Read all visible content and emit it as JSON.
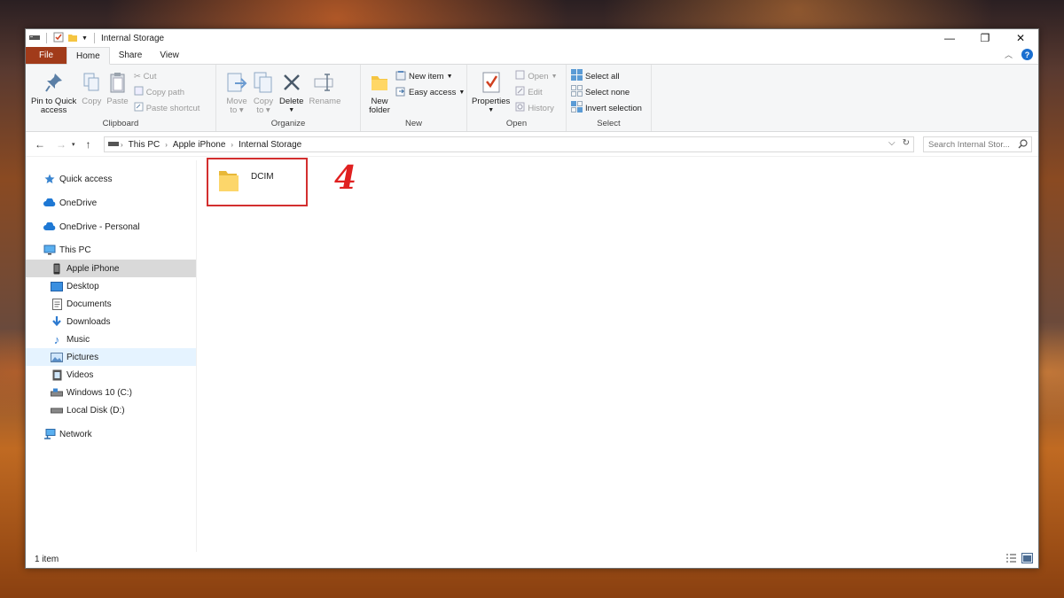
{
  "window": {
    "title": "Internal Storage",
    "controls": {
      "minimize": "—",
      "maximize": "❐",
      "close": "✕"
    }
  },
  "tabs": [
    {
      "label": "File"
    },
    {
      "label": "Home"
    },
    {
      "label": "Share"
    },
    {
      "label": "View"
    }
  ],
  "ribbon": {
    "clipboard": {
      "label": "Clipboard",
      "pin_line1": "Pin to Quick",
      "pin_line2": "access",
      "copy": "Copy",
      "paste": "Paste",
      "cut": "Cut",
      "copy_path": "Copy path",
      "paste_shortcut": "Paste shortcut"
    },
    "organize": {
      "label": "Organize",
      "move_line1": "Move",
      "move_line2": "to",
      "copy_line1": "Copy",
      "copy_line2": "to",
      "delete": "Delete",
      "rename": "Rename"
    },
    "new": {
      "label": "New",
      "folder_line1": "New",
      "folder_line2": "folder",
      "new_item": "New item",
      "easy_access": "Easy access"
    },
    "open": {
      "label": "Open",
      "properties": "Properties",
      "open": "Open",
      "edit": "Edit",
      "history": "History"
    },
    "select": {
      "label": "Select",
      "select_all": "Select all",
      "select_none": "Select none",
      "invert": "Invert selection"
    }
  },
  "address": {
    "crumbs": [
      "This PC",
      "Apple iPhone",
      "Internal Storage"
    ]
  },
  "search": {
    "placeholder": "Search Internal Stor..."
  },
  "navpane": {
    "items": [
      {
        "label": "Quick access",
        "icon": "star-icon"
      },
      {
        "label": "OneDrive",
        "icon": "cloud-icon"
      },
      {
        "label": "OneDrive - Personal",
        "icon": "cloud-icon"
      },
      {
        "label": "This PC",
        "icon": "monitor-icon"
      },
      {
        "label": "Apple iPhone",
        "icon": "phone-icon"
      },
      {
        "label": "Desktop",
        "icon": "desktop-icon"
      },
      {
        "label": "Documents",
        "icon": "document-icon"
      },
      {
        "label": "Downloads",
        "icon": "download-icon"
      },
      {
        "label": "Music",
        "icon": "music-icon"
      },
      {
        "label": "Pictures",
        "icon": "picture-icon"
      },
      {
        "label": "Videos",
        "icon": "video-icon"
      },
      {
        "label": "Windows 10 (C:)",
        "icon": "drive-icon"
      },
      {
        "label": "Local Disk (D:)",
        "icon": "drive-icon"
      },
      {
        "label": "Network",
        "icon": "network-icon"
      }
    ]
  },
  "content": {
    "items": [
      {
        "name": "DCIM",
        "type": "folder"
      }
    ],
    "step_marker": "4"
  },
  "status": {
    "count": "1 item"
  },
  "colors": {
    "file_tab": "#a13b1a",
    "accent": "#1a6fd0",
    "highlight_box": "#d32f2f",
    "selection": "#d9d9d9",
    "hover": "#e5f3ff"
  }
}
